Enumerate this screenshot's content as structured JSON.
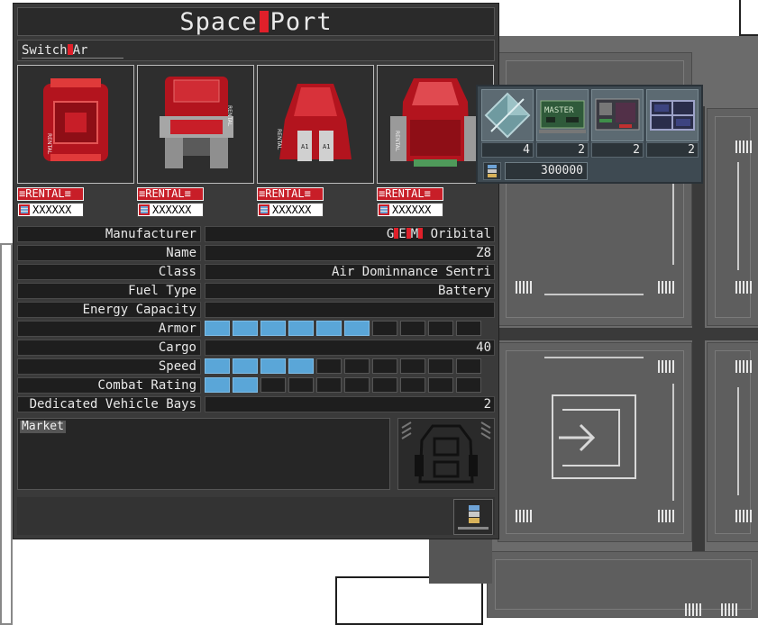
{
  "window": {
    "title_left": "Space",
    "title_right": "Port",
    "switch_label_left": "Switch",
    "switch_label_right": "Ar"
  },
  "ships": [
    {
      "tag": "≡RENTAL≡",
      "id": "XXXXXX"
    },
    {
      "tag": "≡RENTAL≡",
      "id": "XXXXXX"
    },
    {
      "tag": "≡RENTAL≡",
      "id": "XXXXXX"
    },
    {
      "tag": "≡RENTAL≡",
      "id": "XXXXXX"
    }
  ],
  "stats": {
    "manufacturer": {
      "label": "Manufacturer",
      "value_a": "G",
      "value_b": "E",
      "value_c": "M",
      "value_d": "Oribital"
    },
    "name": {
      "label": "Name",
      "value": "Z8"
    },
    "class": {
      "label": "Class",
      "value": "Air Dominnance Sentri"
    },
    "fuel_type": {
      "label": "Fuel Type",
      "value": "Battery"
    },
    "energy_capacity": {
      "label": "Energy Capacity",
      "value": ""
    },
    "armor": {
      "label": "Armor",
      "level": 6,
      "max": 10
    },
    "cargo": {
      "label": "Cargo",
      "value": "40"
    },
    "speed": {
      "label": "Speed",
      "level": 4,
      "max": 10
    },
    "combat_rating": {
      "label": "Combat Rating",
      "level": 2,
      "max": 10
    },
    "vehicle_bays": {
      "label": "Dedicated Vehicle Bays",
      "value": "2"
    }
  },
  "market": {
    "label": "Market"
  },
  "inventory": {
    "slots": [
      {
        "icon": "crystal-icon",
        "count": "4"
      },
      {
        "icon": "master-chip-icon",
        "count": "2",
        "text": "MASTER"
      },
      {
        "icon": "circuit-board-icon",
        "count": "2"
      },
      {
        "icon": "solar-panel-icon",
        "count": "2"
      }
    ],
    "credits": "300000"
  },
  "colors": {
    "rental_red": "#c81e28",
    "bar_blue": "#5aa6d8",
    "title_red": "#e0202a"
  }
}
